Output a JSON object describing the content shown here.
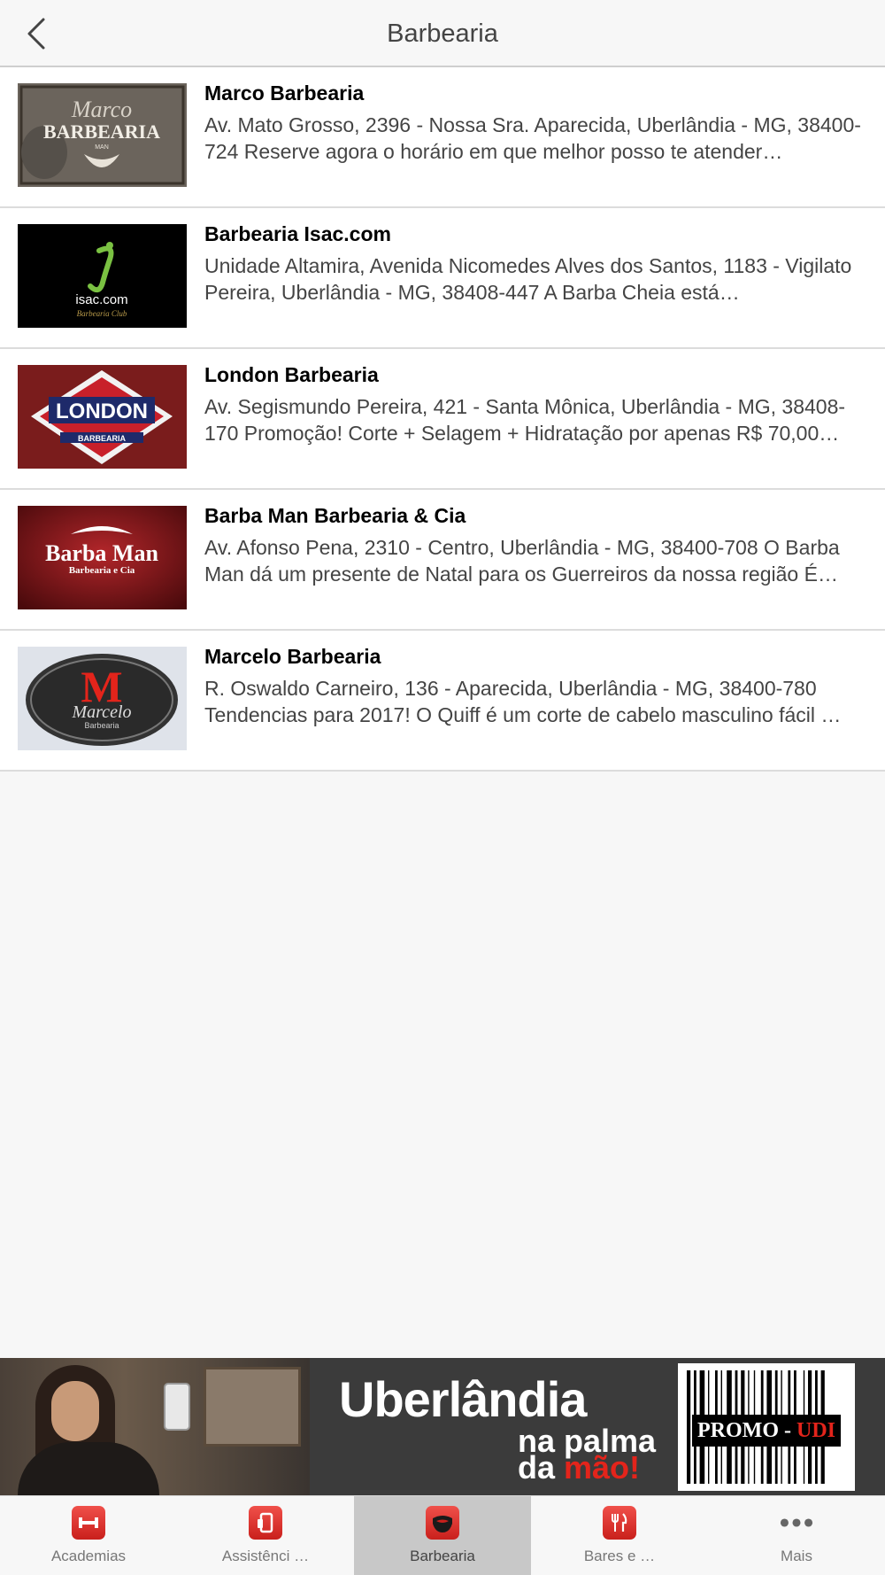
{
  "header": {
    "title": "Barbearia",
    "back_icon": "chevron-left-icon"
  },
  "items": [
    {
      "title": "Marco Barbearia",
      "description": "Av. Mato Grosso, 2396 - Nossa Sra. Aparecida, Uberlândia - MG, 38400-724 Reserve agora o horário em que melhor posso te atender…",
      "logo_text": [
        "Marco",
        "BARBEARIA",
        "MAN"
      ]
    },
    {
      "title": "Barbearia Isac.com",
      "description": "Unidade Altamira, Avenida Nicomedes Alves dos Santos, 1183 - Vigilato Pereira, Uberlândia - MG, 38408-447 A Barba Cheia está…",
      "logo_text": [
        "isac.com",
        "Barbearia Club"
      ]
    },
    {
      "title": "London Barbearia",
      "description": "Av. Segismundo Pereira, 421 - Santa Mônica, Uberlândia - MG, 38408-170 Promoção! Corte + Selagem + Hidratação por apenas R$ 70,00…",
      "logo_text": [
        "LONDON",
        "BARBEARIA"
      ]
    },
    {
      "title": "Barba Man Barbearia & Cia",
      "description": "Av. Afonso Pena, 2310 - Centro, Uberlândia - MG, 38400-708 O Barba Man dá um presente de Natal para os Guerreiros da nossa região É…",
      "logo_text": [
        "Barba Man",
        "Barbearia e Cia"
      ]
    },
    {
      "title": "Marcelo Barbearia",
      "description": "R. Oswaldo Carneiro, 136 - Aparecida, Uberlândia - MG, 38400-780 Tendencias para 2017! O Quiff é um corte de cabelo masculino fácil …",
      "logo_text": [
        "M",
        "Marcelo",
        "Barbearia"
      ]
    }
  ],
  "banner": {
    "city": "Uberlândia",
    "tagline_1": "na palma",
    "tagline_2_prefix": "da ",
    "tagline_2_highlight": "mão!",
    "promo_prefix": "PROMO - ",
    "promo_highlight": "UDI",
    "colors": {
      "highlight": "#e3241b",
      "background": "#3b3b3b"
    }
  },
  "tabs": [
    {
      "label": "Academias",
      "icon": "dumbbell-icon",
      "active": false
    },
    {
      "label": "Assistênci …",
      "icon": "phone-repair-icon",
      "active": false
    },
    {
      "label": "Barbearia",
      "icon": "mustache-icon",
      "active": true
    },
    {
      "label": "Bares e …",
      "icon": "fork-knife-icon",
      "active": false
    },
    {
      "label": "Mais",
      "icon": "more-dots-icon",
      "active": false
    }
  ],
  "colors": {
    "accent": "#e3241b",
    "active_tab_bg": "#c8c8c8",
    "page_bg": "#f7f7f7"
  }
}
